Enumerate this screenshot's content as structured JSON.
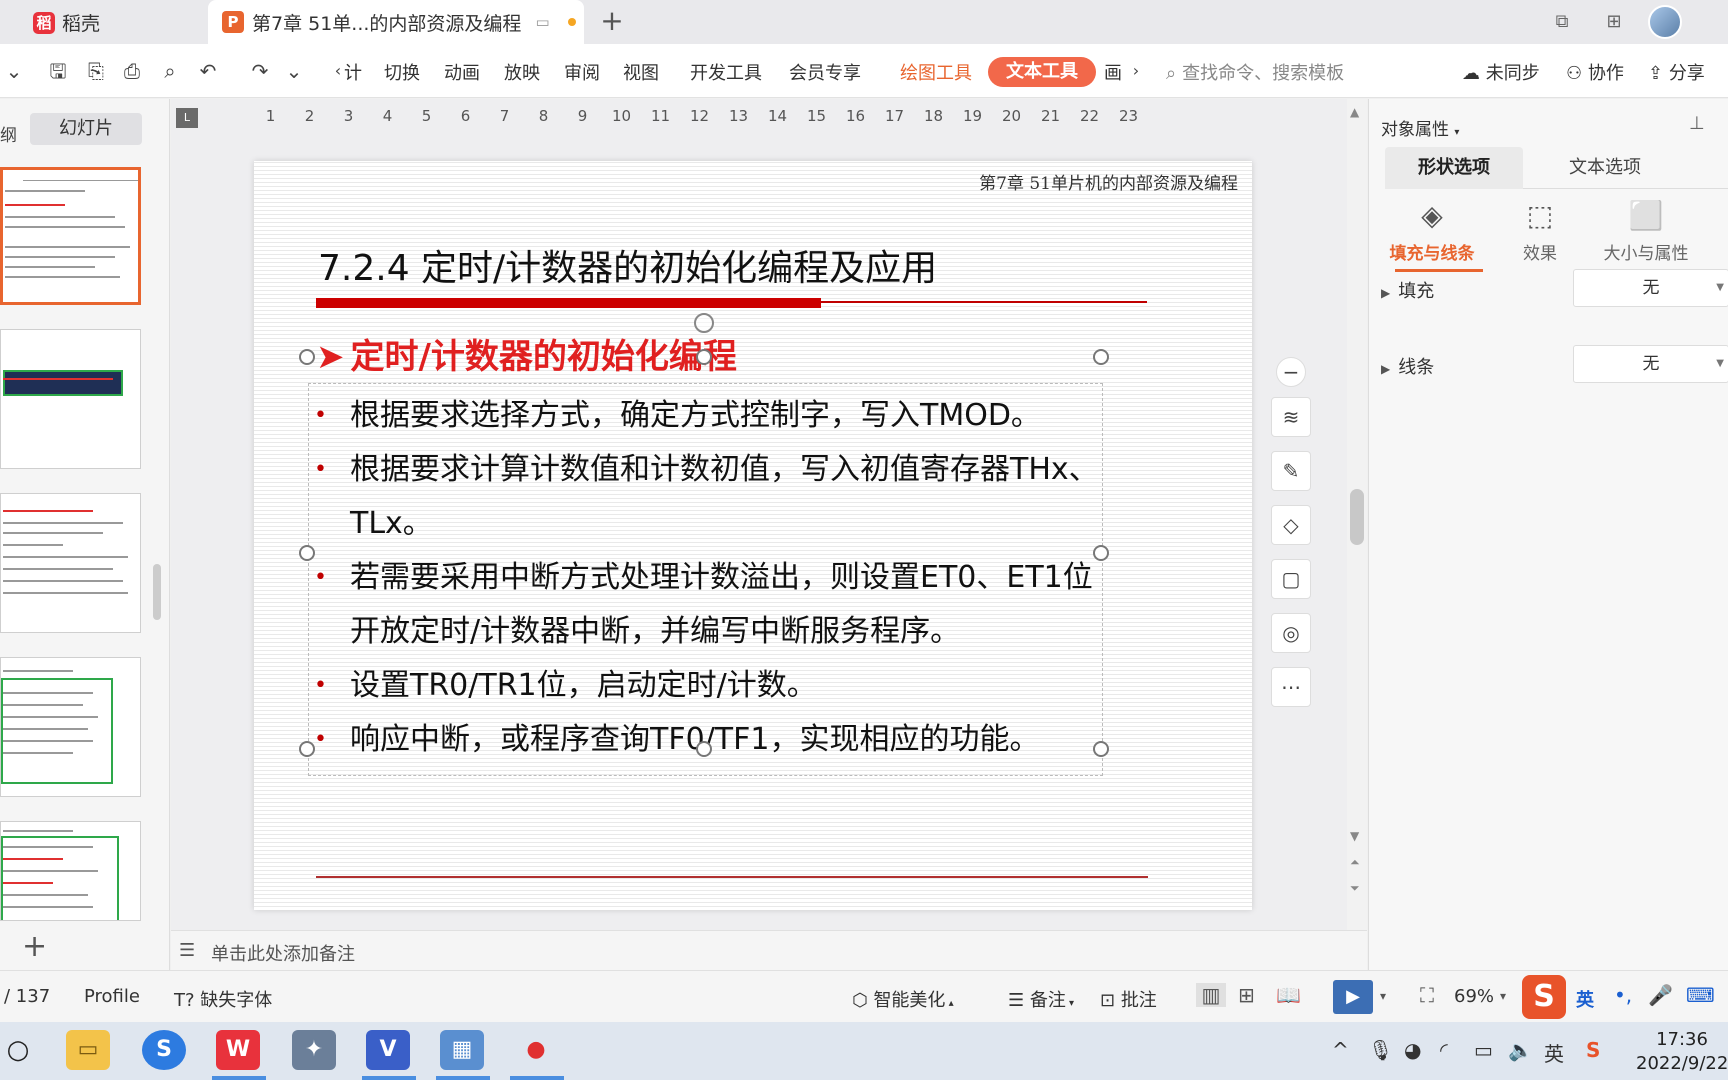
{
  "tabs": {
    "app_label": "稻壳",
    "app_logo": "稻",
    "doc_label": "第7章  51单...的内部资源及编程",
    "doc_logo": "P",
    "new_tab": "+"
  },
  "toolbar": {
    "menu": [
      "切换",
      "动画",
      "放映",
      "审阅",
      "视图",
      "开发工具",
      "会员专享"
    ],
    "menu_left_partial": "计",
    "draw_tool": "绘图工具",
    "text_tool": "文本工具",
    "more_partial": "画",
    "search_placeholder": "查找命令、搜索模板",
    "sync": "未同步",
    "collab": "协作",
    "share": "分享"
  },
  "left_panel": {
    "tab_outline_partial": "纲",
    "tab_slides": "幻灯片"
  },
  "ruler": {
    "numbers": [
      "1",
      "2",
      "3",
      "4",
      "5",
      "6",
      "7",
      "8",
      "9",
      "10",
      "11",
      "12",
      "13",
      "14",
      "15",
      "16",
      "17",
      "18",
      "19",
      "20",
      "21",
      "22",
      "23"
    ]
  },
  "slide": {
    "header": "第7章  51单片机的内部资源及编程",
    "title": "7.2.4 定时/计数器的初始化编程及应用",
    "subtitle_arrow": "➤",
    "subtitle": "定时/计数器的初始化编程",
    "bullet_mark": "•",
    "bullets": [
      "根据要求选择方式，确定方式控制字，写入TMOD。",
      "根据要求计算计数值和计数初值，写入初值寄存器THx、TLx。",
      "若需要采用中断方式处理计数溢出，则设置ET0、ET1位开放定时/计数器中断，并编写中断服务程序。",
      "设置TR0/TR1位，启动定时/计数。",
      "响应中断，或程序查询TF0/TF1，实现相应的功能。"
    ]
  },
  "notes": {
    "placeholder": "单击此处添加备注"
  },
  "right_panel": {
    "title": "对象属性",
    "tab_shape": "形状选项",
    "tab_text": "文本选项",
    "sub_fill_line": "填充与线条",
    "sub_effect": "效果",
    "sub_size": "大小与属性",
    "fill_label": "填充",
    "fill_value": "无",
    "line_label": "线条",
    "line_value": "无"
  },
  "status": {
    "page": "/ 137",
    "profile": "Profile",
    "missing_font": "缺失字体",
    "beautify": "智能美化",
    "notes": "备注",
    "comment": "批注",
    "zoom": "69%",
    "ime_lang": "英"
  },
  "taskbar": {
    "time": "17:36",
    "date": "2022/9/22"
  },
  "colors": {
    "accent": "#e8652f",
    "text_tool_bg": "#f2684a",
    "slide_red": "#cc0000"
  }
}
